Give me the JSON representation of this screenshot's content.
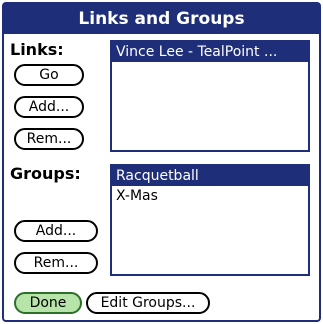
{
  "dialog": {
    "title": "Links and Groups"
  },
  "links": {
    "label": "Links:",
    "items": [
      {
        "text": "Vince Lee - TealPoint ...",
        "selected": true
      }
    ],
    "go_label": "Go",
    "add_label": "Add...",
    "remove_label": "Rem..."
  },
  "groups": {
    "label": "Groups:",
    "items": [
      {
        "text": "Racquetball",
        "selected": true
      },
      {
        "text": "X-Mas",
        "selected": false
      }
    ],
    "add_label": "Add...",
    "remove_label": "Rem..."
  },
  "footer": {
    "done_label": "Done",
    "edit_groups_label": "Edit Groups..."
  },
  "colors": {
    "accent": "#1e2e78",
    "done_button": "#b7e4a8"
  }
}
